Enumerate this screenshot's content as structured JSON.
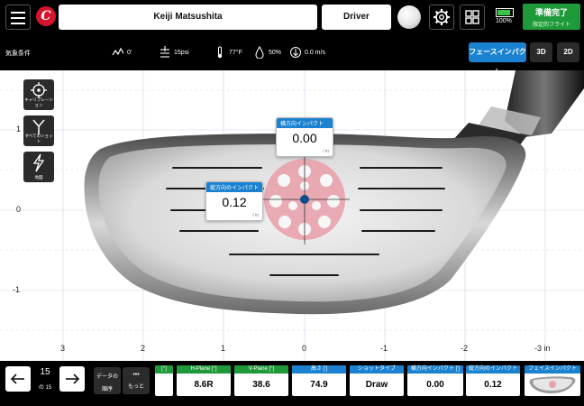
{
  "header": {
    "player_name": "Keiji Matsushita",
    "club": "Driver",
    "battery": "100%",
    "status_title": "準備完了",
    "status_sub": "限定的フライト",
    "logo_letter": "C"
  },
  "conditions": {
    "label": "気象条件",
    "elevation": "0'",
    "pressure": "15psi",
    "temperature": "77°F",
    "humidity": "50%",
    "wind": "0.0 m/s"
  },
  "view_tabs": [
    {
      "label": "フェースインパクト",
      "active": true
    },
    {
      "label": "3D",
      "active": false
    },
    {
      "label": "2D",
      "active": false
    }
  ],
  "tools": [
    {
      "label": "キャリブレーション",
      "icon": "crosshair-icon"
    },
    {
      "label": "すべてのショット",
      "icon": "fork-icon"
    },
    {
      "label": "地図",
      "icon": "lightning-icon"
    }
  ],
  "axes": {
    "y_ticks": [
      "1",
      "0",
      "-1"
    ],
    "x_ticks": [
      "3",
      "2",
      "1",
      "0",
      "-1",
      "-2",
      "-3 in"
    ]
  },
  "callouts": {
    "horizontal": {
      "title": "横方向インパクト",
      "value": "0.00",
      "unit": "/ in"
    },
    "vertical": {
      "title": "縦方向のインパクト",
      "value": "0.12",
      "unit": "/ in"
    }
  },
  "shot_nav": {
    "current": "15",
    "total": "の 15"
  },
  "data_order": {
    "line1": "データの",
    "line2": "順序"
  },
  "more": {
    "dots": "•••",
    "label": "もっと"
  },
  "metrics": [
    {
      "label": "[°]",
      "value": "",
      "color": "#1f9a3a"
    },
    {
      "label": "H-Plane [°]",
      "value": "8.6R",
      "color": "#1f9a3a"
    },
    {
      "label": "V-Plane [°]",
      "value": "38.6",
      "color": "#1f9a3a"
    },
    {
      "label": "高さ [']",
      "value": "74.9",
      "color": "#1a82d0"
    },
    {
      "label": "ショットタイプ",
      "value": "Draw",
      "color": "#1a82d0"
    },
    {
      "label": "横方向インパクト [']",
      "value": "0.00",
      "color": "#1a82d0"
    },
    {
      "label": "縦方向のインパクト [']",
      "value": "0.12",
      "color": "#1a82d0"
    },
    {
      "label": "フェイスインパクト",
      "value": "",
      "color": "#1a82d0"
    }
  ],
  "colors": {
    "accent": "#1a82d0",
    "ready": "#1f9a3a",
    "dispersion": "#e8a2ac",
    "impact": "#0f4e8a"
  }
}
